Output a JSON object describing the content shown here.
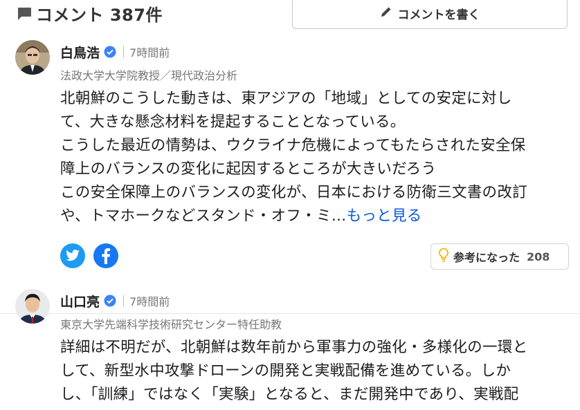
{
  "header": {
    "title": "コメント 387件",
    "write_button": "コメントを書く"
  },
  "comments": [
    {
      "name": "白鳥浩",
      "time": "7時間前",
      "role": "法政大学大学院教授／現代政治分析",
      "lines": [
        "北朝鮮のこうした動きは、東アジアの「地域」としての安定に対し",
        "て、大きな懸念材料を提起することとなっている。",
        "こうした最近の情勢は、ウクライナ危機によってもたらされた安全保",
        "障上のバランスの変化に起因するところが大きいだろう",
        "この安全保障上のバランスの変化が、日本における防衛三文書の改訂",
        "や、トマホークなどスタンド・オフ・ミ…"
      ],
      "more_link": "もっと見る",
      "helpful_label": "参考になった",
      "helpful_count": "208"
    },
    {
      "name": "山口亮",
      "time": "7時間前",
      "role": "東京大学先端科学技術研究センター特任助教",
      "lines": [
        "詳細は不明だが、北朝鮮は数年前から軍事力の強化・多様化の一環と",
        "して、新型水中攻撃ドローンの開発と実戦配備を進めている。しか",
        "し、「訓練」ではなく「実験」となると、まだ開発中であり、実戦配"
      ]
    }
  ],
  "colors": {
    "link": "#0b59d6",
    "verified": "#3b82f6",
    "twitter": "#1d9bf0",
    "facebook": "#1877f2",
    "bulb": "#f5b400"
  },
  "icons": {
    "header": "comment-bubble-icon",
    "write": "pencil-icon",
    "verified": "verified-badge-icon",
    "share": [
      "twitter-icon",
      "facebook-icon"
    ],
    "helpful": "lightbulb-icon"
  }
}
